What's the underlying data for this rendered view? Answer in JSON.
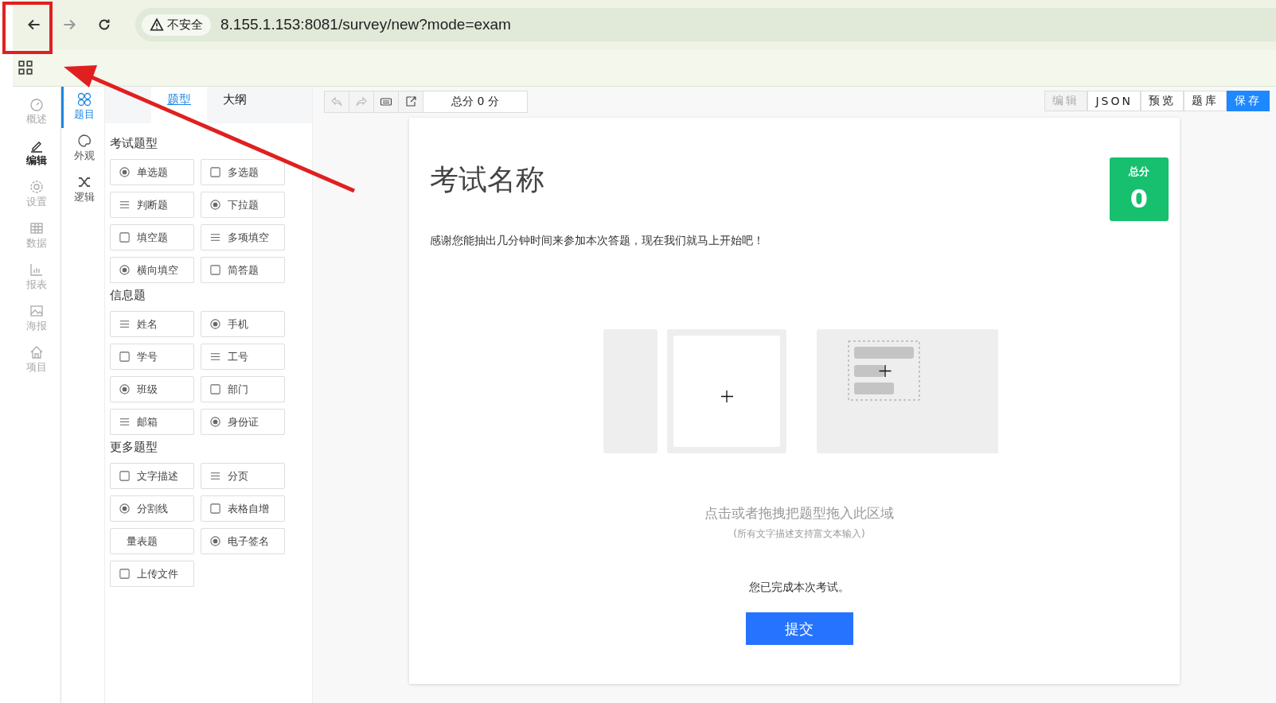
{
  "browser": {
    "security_label": "不安全",
    "url": "8.155.1.153:8081/survey/new?mode=exam"
  },
  "nav": [
    {
      "label": "概述",
      "selected": false
    },
    {
      "label": "编辑",
      "selected": true
    },
    {
      "label": "设置",
      "selected": false
    },
    {
      "label": "数据",
      "selected": false
    },
    {
      "label": "报表",
      "selected": false
    },
    {
      "label": "海报",
      "selected": false
    },
    {
      "label": "项目",
      "selected": false
    }
  ],
  "subnav": [
    {
      "label": "题目",
      "selected": true
    },
    {
      "label": "外观",
      "selected": false
    },
    {
      "label": "逻辑",
      "selected": false
    }
  ],
  "panel_tabs": [
    {
      "label": "题型",
      "selected": true
    },
    {
      "label": "大纲",
      "selected": false
    }
  ],
  "groups": [
    {
      "title": "考试题型",
      "items": [
        {
          "label": "单选题",
          "icon": true
        },
        {
          "label": "多选题",
          "icon": true
        },
        {
          "label": "判断题",
          "icon": true
        },
        {
          "label": "下拉题",
          "icon": true
        },
        {
          "label": "填空题",
          "icon": true
        },
        {
          "label": "多项填空",
          "icon": true
        },
        {
          "label": "横向填空",
          "icon": true
        },
        {
          "label": "简答题",
          "icon": true
        }
      ]
    },
    {
      "title": "信息题",
      "items": [
        {
          "label": "姓名",
          "icon": true
        },
        {
          "label": "手机",
          "icon": true
        },
        {
          "label": "学号",
          "icon": true
        },
        {
          "label": "工号",
          "icon": true
        },
        {
          "label": "班级",
          "icon": true
        },
        {
          "label": "部门",
          "icon": true
        },
        {
          "label": "邮箱",
          "icon": true
        },
        {
          "label": "身份证",
          "icon": true
        }
      ]
    },
    {
      "title": "更多题型",
      "items": [
        {
          "label": "文字描述",
          "icon": true
        },
        {
          "label": "分页",
          "icon": true
        },
        {
          "label": "分割线",
          "icon": true
        },
        {
          "label": "表格自增",
          "icon": true
        },
        {
          "label": "量表题",
          "icon": false
        },
        {
          "label": "电子签名",
          "icon": true
        },
        {
          "label": "上传文件",
          "icon": true
        }
      ]
    }
  ],
  "toolbar": {
    "tools": [
      {
        "disabled": true
      },
      {
        "disabled": true
      },
      {
        "disabled": false
      },
      {
        "disabled": false
      }
    ],
    "total": "总分 0 分",
    "actions": [
      {
        "label": "编辑",
        "kind": "disabled"
      },
      {
        "label": "JSON",
        "kind": "normal"
      },
      {
        "label": "预览",
        "kind": "normal"
      },
      {
        "label": "题库",
        "kind": "normal"
      },
      {
        "label": "保存",
        "kind": "primary"
      }
    ]
  },
  "paper": {
    "title": "考试名称",
    "description": "感谢您能抽出几分钟时间来参加本次答题，现在我们就马上开始吧！",
    "score_badge": {
      "label": "总分",
      "value": "0"
    },
    "drop_hint": "点击或者拖拽把题型拖入此区域",
    "drop_subhint": "(所有文字描述支持富文本输入)",
    "finish_text": "您已完成本次考试。",
    "submit": "提交"
  }
}
